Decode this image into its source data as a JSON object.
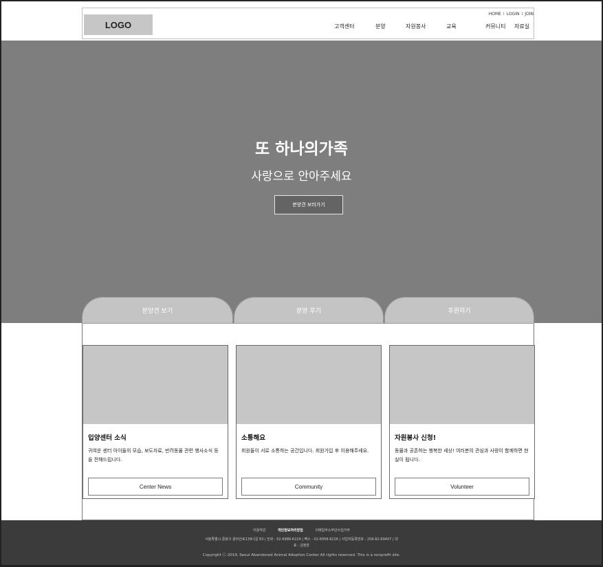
{
  "header": {
    "logo": "LOGO",
    "util": [
      "HOME",
      "LOGIN",
      "JOIN"
    ],
    "util_sep": "I",
    "nav": [
      "고객센터",
      "분양",
      "자원봉사",
      "교육",
      "커뮤니티",
      "자료실"
    ]
  },
  "hero": {
    "title": "또 하나의가족",
    "subtitle": "사랑으로 안아주세요",
    "button": "분양견 보러가기"
  },
  "tabs": [
    "분양견 보기",
    "분양 후기",
    "후원하기"
  ],
  "cards": [
    {
      "title": "입양센터 소식",
      "desc": "귀여운 센터 아이들의 모습, 보도자료, 반려동물 관련 행사소식 등을 전해드립니다.",
      "button": "Center News"
    },
    {
      "title": "소통해요",
      "desc": "회원들이 서로 소통하는 공간입니다. 회원가입 후 이용해주세요.",
      "button": "Community"
    },
    {
      "title": "자원봉사 신청!",
      "desc": "동물과 공존하는 행복한 세상! 여러분의 관심과 사랑이 함께하면 현실이 됩니다.",
      "button": "Volunteer"
    }
  ],
  "footer": {
    "links": [
      "이용약관",
      "개인정보처리방침",
      "이메일주소무단수집거부"
    ],
    "address": "서울특별시 중랑구 용마산로139나길 83   |   전화 : 02-6988-6224   |   팩스 : 02-6958-6226   |   사업자등록번호 : 209-82-69407   |   대",
    "address2": "표 : 김정훈",
    "copyright": "Copyright ⓒ 2019, Seoul Abandoned Animal Adoption Center All rights reserved. This is a nonprofit site."
  }
}
